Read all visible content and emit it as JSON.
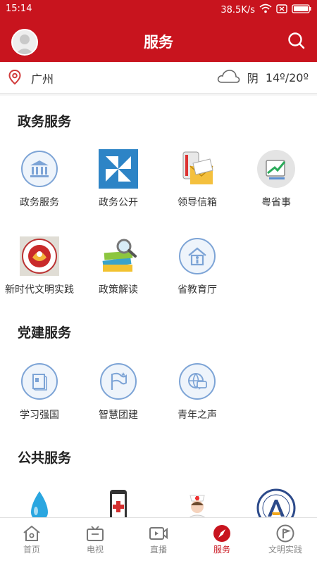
{
  "status": {
    "time": "15:14",
    "speed": "38.5K/s"
  },
  "header": {
    "title": "服务"
  },
  "location": {
    "city": "广州",
    "weather": "阴",
    "temperature": "14º/20º"
  },
  "sections": [
    {
      "title": "政务服务",
      "items": [
        {
          "label": "政务服务",
          "icon": "bank-icon"
        },
        {
          "label": "政务公开",
          "icon": "gov-public-icon"
        },
        {
          "label": "领导信箱",
          "icon": "mailbox-icon"
        },
        {
          "label": "粤省事",
          "icon": "yue-app-icon"
        },
        {
          "label": "新时代文明实践",
          "icon": "civilization-logo"
        },
        {
          "label": "政策解读",
          "icon": "policy-books-icon"
        },
        {
          "label": "省教育厅",
          "icon": "education-house-icon"
        }
      ]
    },
    {
      "title": "党建服务",
      "items": [
        {
          "label": "学习强国",
          "icon": "study-book-icon"
        },
        {
          "label": "智慧团建",
          "icon": "flag-icon"
        },
        {
          "label": "青年之声",
          "icon": "globe-chat-icon"
        }
      ]
    },
    {
      "title": "公共服务",
      "items": [
        {
          "label": "",
          "icon": "water-drop-icon"
        },
        {
          "label": "",
          "icon": "medical-phone-icon"
        },
        {
          "label": "",
          "icon": "nurse-icon"
        },
        {
          "label": "",
          "icon": "emblem-logo"
        }
      ]
    }
  ],
  "tabs": [
    {
      "label": "首页",
      "icon": "home-icon"
    },
    {
      "label": "电视",
      "icon": "tv-icon"
    },
    {
      "label": "直播",
      "icon": "live-video-icon"
    },
    {
      "label": "服务",
      "icon": "compass-icon",
      "active": true
    },
    {
      "label": "文明实践",
      "icon": "flag-circle-icon"
    }
  ],
  "colors": {
    "brand": "#c8141e",
    "iconBlue": "#7da4d6"
  }
}
